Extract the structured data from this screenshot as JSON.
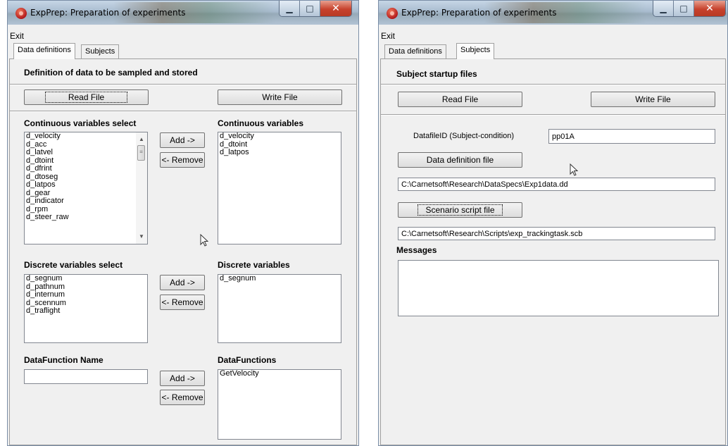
{
  "window1": {
    "title": "ExpPrep: Preparation of experiments",
    "controls": {
      "minimize": "▁",
      "maximize": "□",
      "close": "✕"
    },
    "menu": {
      "exit": "Exit"
    },
    "tabs": [
      {
        "label": "Data definitions",
        "active": true
      },
      {
        "label": "Subjects",
        "active": false
      }
    ],
    "heading": "Definition of data to be sampled and stored",
    "read_file": "Read File",
    "write_file": "Write File",
    "continuous_select_title": "Continuous variables select",
    "continuous_select_items": [
      "d_velocity",
      "d_acc",
      "d_latvel",
      "d_dtoint",
      "d_dfrint",
      "d_dtoseg",
      "d_latpos",
      "d_gear",
      "d_indicator",
      "d_rpm",
      "d_steer_raw"
    ],
    "continuous_title": "Continuous variables",
    "continuous_items": [
      "d_velocity",
      "d_dtoint",
      "d_latpos"
    ],
    "discrete_select_title": "Discrete variables select",
    "discrete_select_items": [
      "d_segnum",
      "d_pathnum",
      "d_internum",
      "d_scennum",
      "d_traflight"
    ],
    "discrete_title": "Discrete variables",
    "discrete_items": [
      "d_segnum"
    ],
    "datafunction_name_title": "DataFunction Name",
    "datafunction_name_value": "",
    "datafunctions_title": "DataFunctions",
    "datafunctions_items": [
      "GetVelocity"
    ],
    "add_label": "Add ->",
    "remove_label": "<- Remove",
    "scroll_up": "▲",
    "scroll_down": "▼",
    "scroll_grip": "≡"
  },
  "window2": {
    "title": "ExpPrep: Preparation of experiments",
    "controls": {
      "minimize": "▁",
      "maximize": "□",
      "close": "✕"
    },
    "menu": {
      "exit": "Exit"
    },
    "tabs": [
      {
        "label": "Data definitions",
        "active": false
      },
      {
        "label": "Subjects",
        "active": true
      }
    ],
    "heading": "Subject startup files",
    "read_file": "Read File",
    "write_file": "Write File",
    "datafile_id_label": "DatafileID (Subject-condition)",
    "datafile_id_value": "pp01A",
    "data_definition_button": "Data definition file",
    "data_definition_path": "C:\\Carnetsoft\\Research\\DataSpecs\\Exp1data.dd",
    "scenario_button": "Scenario script file",
    "scenario_path": "C:\\Carnetsoft\\Research\\Scripts\\exp_trackingtask.scb",
    "messages_title": "Messages",
    "messages_text": ""
  }
}
